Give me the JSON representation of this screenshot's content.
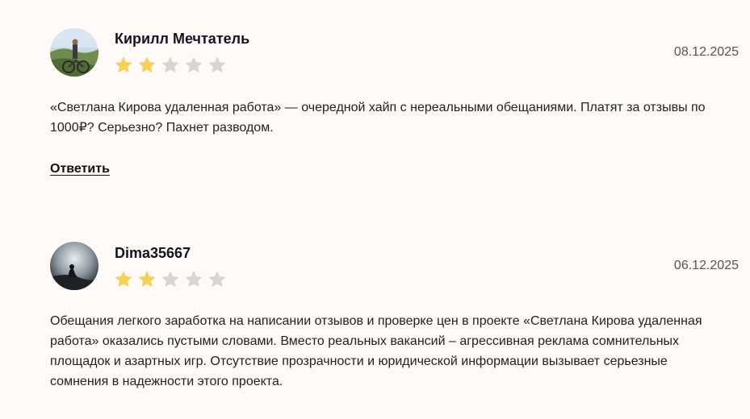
{
  "reviews": [
    {
      "author": "Кирилл Мечтатель",
      "date": "08.12.2025",
      "rating": 2,
      "max_rating": 5,
      "text": "«Светлана Кирова удаленная работа» — очередной хайп с нереальными обещаниями. Платят за отзывы по 1000₽? Серьезно? Пахнет разводом.",
      "reply_label": "Ответить"
    },
    {
      "author": "Dima35667",
      "date": "06.12.2025",
      "rating": 2,
      "max_rating": 5,
      "text": "Обещания легкого заработка на написании отзывов и проверке цен в проекте «Светлана Кирова удаленная работа» оказались пустыми словами. Вместо реальных вакансий – агрессивная реклама сомнительных площадок и азартных игр. Отсутствие прозрачности и юридической информации вызывает серьезные сомнения в надежности этого проекта."
    }
  ],
  "colors": {
    "star_filled": "#f7d154",
    "star_empty": "#d6d6d6",
    "background": "#fdfaf7"
  }
}
